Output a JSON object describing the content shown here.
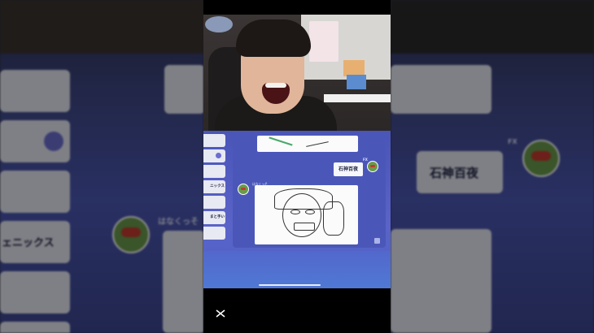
{
  "game": {
    "list_items": [
      "",
      "",
      "",
      "ニックス",
      "",
      "まと手い",
      ""
    ],
    "guess_text": "石神百夜",
    "fx_label": "FX",
    "player_name": "はなくっそ"
  },
  "side_left": {
    "phoenix_text": "ェニックス",
    "player_name": "はなくっそ"
  },
  "side_right": {
    "guess_text": "石神百夜",
    "fx_label": "FX"
  },
  "watermark": {
    "app_icon": "capcut-icon"
  }
}
